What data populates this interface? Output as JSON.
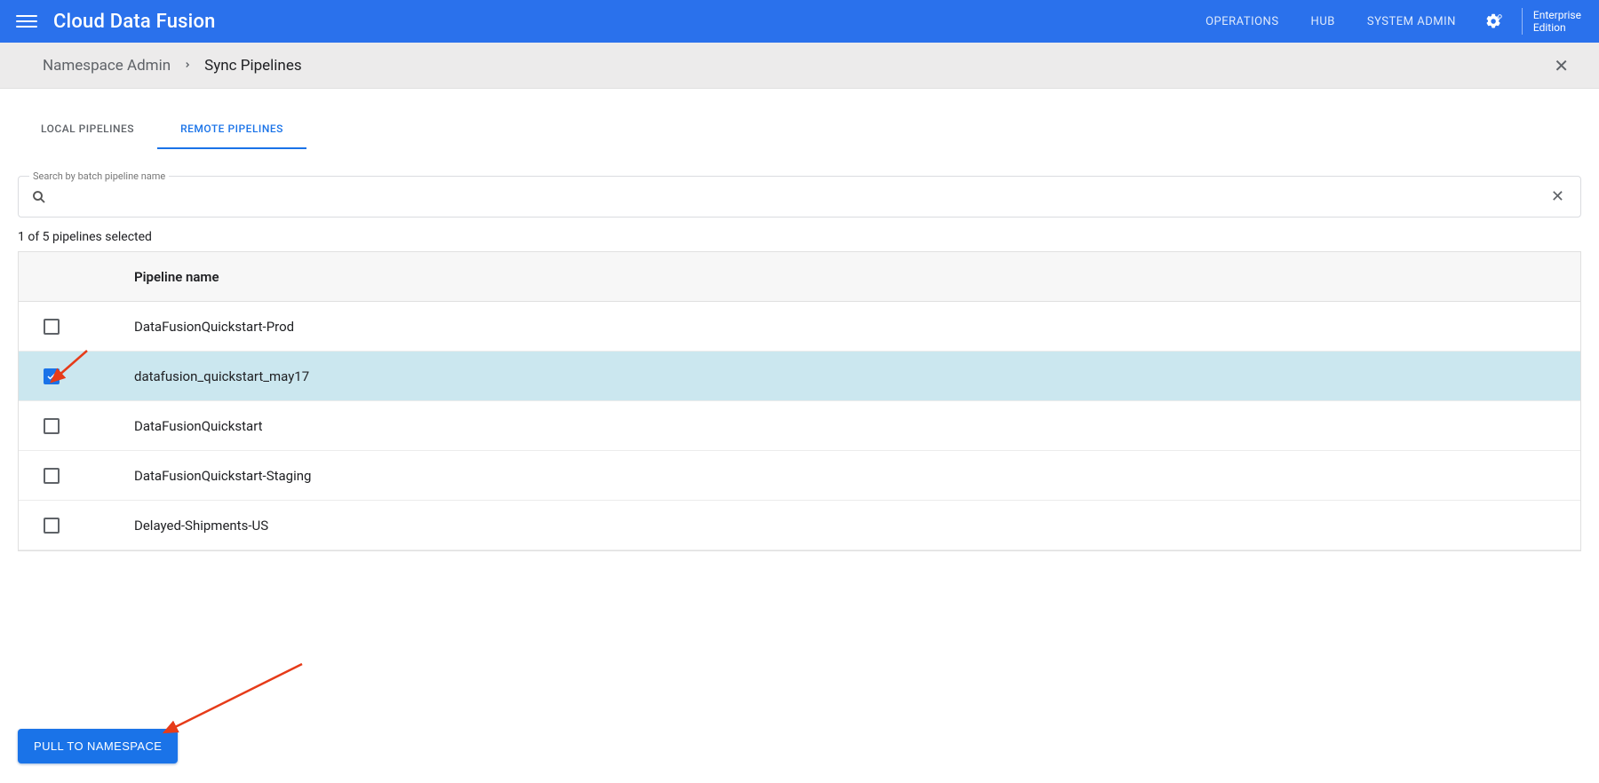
{
  "appbar": {
    "brand": "Cloud Data Fusion",
    "links": {
      "operations": "OPERATIONS",
      "hub": "HUB",
      "system_admin": "SYSTEM ADMIN"
    },
    "edition_line1": "Enterprise",
    "edition_line2": "Edition"
  },
  "breadcrumb": {
    "root": "Namespace Admin",
    "current": "Sync Pipelines"
  },
  "tabs": {
    "local": "LOCAL PIPELINES",
    "remote": "REMOTE PIPELINES"
  },
  "search": {
    "legend": "Search by batch pipeline name",
    "value": ""
  },
  "selection_text": "1 of 5 pipelines selected",
  "columns": {
    "name": "Pipeline name"
  },
  "rows": [
    {
      "name": "DataFusionQuickstart-Prod",
      "checked": false
    },
    {
      "name": "datafusion_quickstart_may17",
      "checked": true
    },
    {
      "name": "DataFusionQuickstart",
      "checked": false
    },
    {
      "name": "DataFusionQuickstart-Staging",
      "checked": false
    },
    {
      "name": "Delayed-Shipments-US",
      "checked": false
    }
  ],
  "pull_button": "PULL TO NAMESPACE"
}
